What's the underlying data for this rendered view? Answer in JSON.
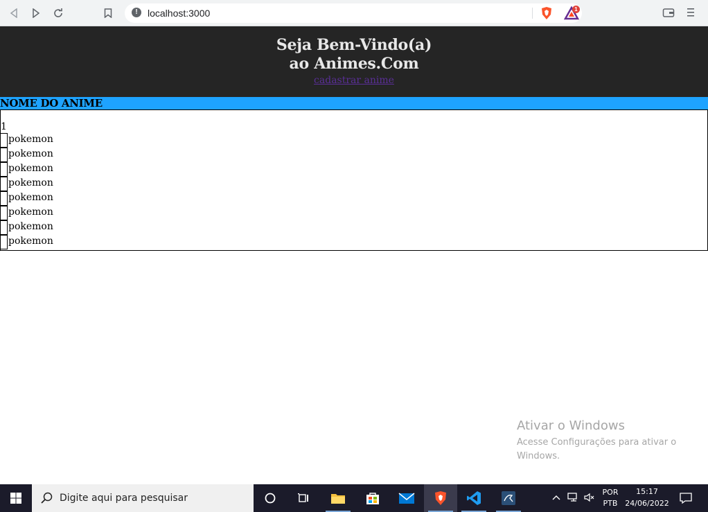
{
  "browser": {
    "url": "localhost:3000",
    "rewards_badge": "1"
  },
  "page": {
    "title": "Seja Bem-Vindo(a) ao Animes.Com",
    "link": "cadastrar anime",
    "column_header": "NOME DO ANIME",
    "row_count": "1",
    "items": [
      "pokemon",
      "pokemon",
      "pokemon",
      "pokemon",
      "pokemon",
      "pokemon",
      "pokemon",
      "pokemon"
    ]
  },
  "watermark": {
    "title": "Ativar o Windows",
    "subtitle": "Acesse Configurações para ativar o Windows."
  },
  "taskbar": {
    "search_placeholder": "Digite aqui para pesquisar",
    "lang_top": "POR",
    "lang_bottom": "PTB",
    "time": "15:17",
    "date": "24/06/2022"
  },
  "colors": {
    "header_bg": "#252525",
    "bar_bg": "#1ea3ff",
    "link": "#5a2f97"
  }
}
